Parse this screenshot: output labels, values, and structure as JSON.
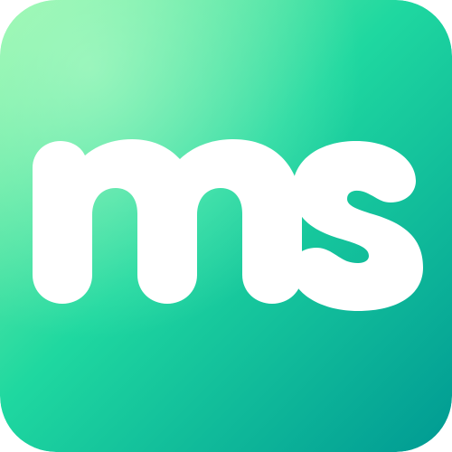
{
  "app_icon": {
    "name": "ms-app-icon",
    "logo_text": "ms",
    "colors": {
      "gradient_top_left": "#8DF5A8",
      "gradient_mid": "#1FD8A0",
      "gradient_bottom_right": "#009A93",
      "letter_fill": "#FFFFFF"
    }
  }
}
